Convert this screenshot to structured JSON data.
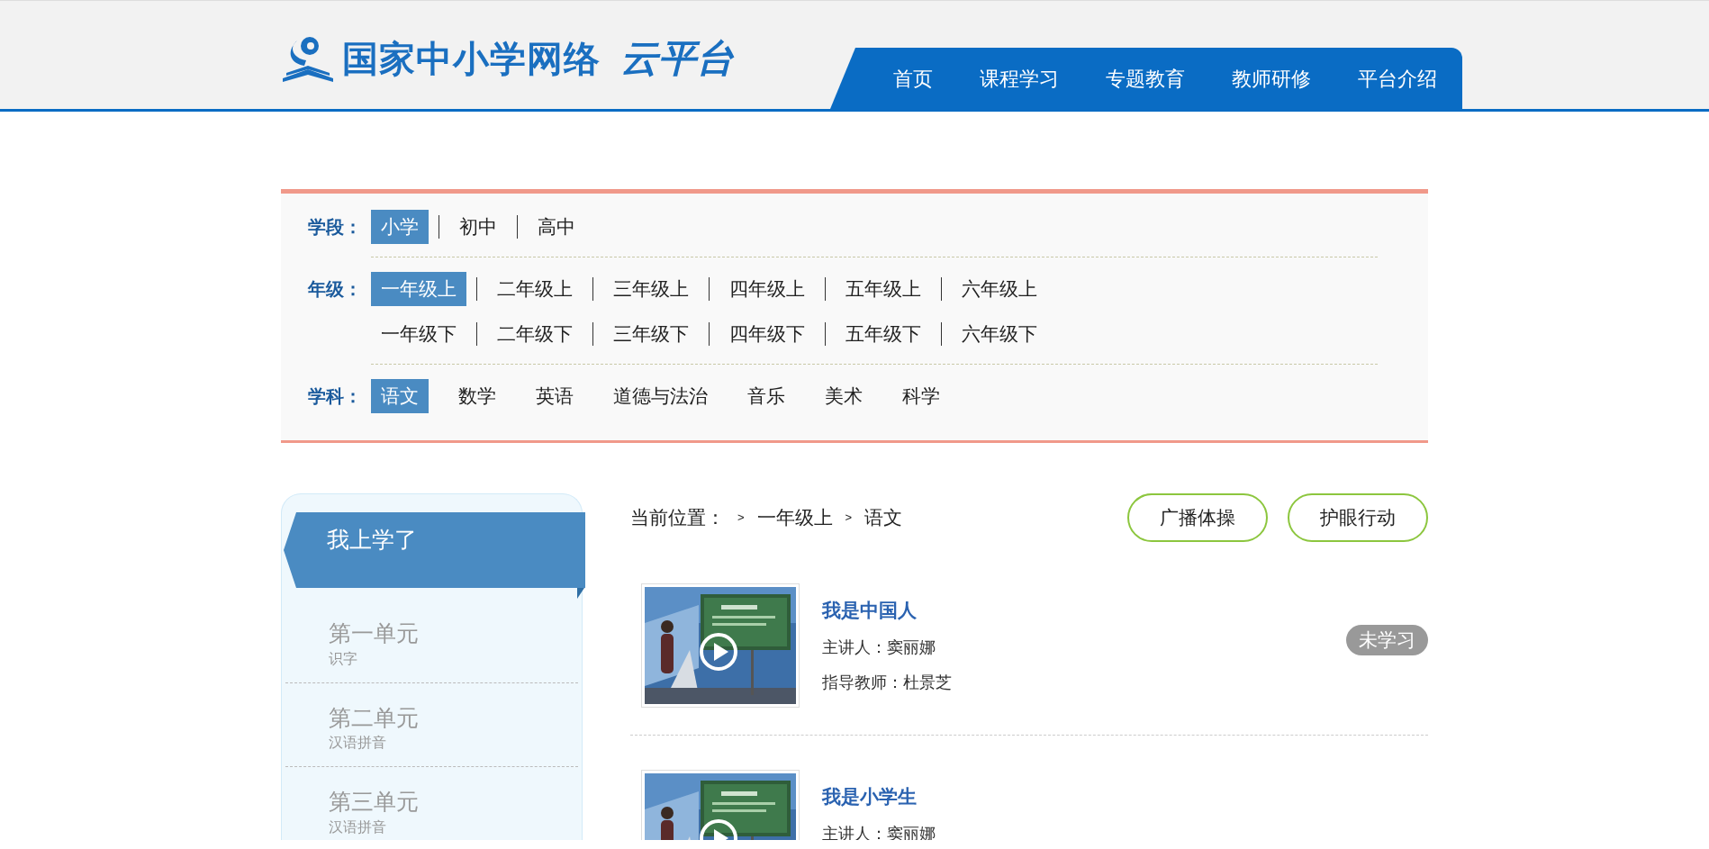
{
  "header": {
    "logo_text": "国家中小学网络",
    "logo_brand": "云平台",
    "nav": [
      {
        "label": "首页"
      },
      {
        "label": "课程学习"
      },
      {
        "label": "专题教育"
      },
      {
        "label": "教师研修"
      },
      {
        "label": "平台介绍"
      }
    ]
  },
  "filters": [
    {
      "label": "学段：",
      "dividers": true,
      "rows": [
        [
          {
            "label": "小学",
            "selected": true
          },
          {
            "label": "初中",
            "selected": false
          },
          {
            "label": "高中",
            "selected": false
          }
        ]
      ]
    },
    {
      "label": "年级：",
      "dividers": true,
      "rows": [
        [
          {
            "label": "一年级上",
            "selected": true
          },
          {
            "label": "二年级上",
            "selected": false
          },
          {
            "label": "三年级上",
            "selected": false
          },
          {
            "label": "四年级上",
            "selected": false
          },
          {
            "label": "五年级上",
            "selected": false
          },
          {
            "label": "六年级上",
            "selected": false
          }
        ],
        [
          {
            "label": "一年级下",
            "selected": false
          },
          {
            "label": "二年级下",
            "selected": false
          },
          {
            "label": "三年级下",
            "selected": false
          },
          {
            "label": "四年级下",
            "selected": false
          },
          {
            "label": "五年级下",
            "selected": false
          },
          {
            "label": "六年级下",
            "selected": false
          }
        ]
      ]
    },
    {
      "label": "学科：",
      "dividers": false,
      "rows": [
        [
          {
            "label": "语文",
            "selected": true
          },
          {
            "label": "数学",
            "selected": false
          },
          {
            "label": "英语",
            "selected": false
          },
          {
            "label": "道德与法治",
            "selected": false
          },
          {
            "label": "音乐",
            "selected": false
          },
          {
            "label": "美术",
            "selected": false
          },
          {
            "label": "科学",
            "selected": false
          }
        ]
      ]
    }
  ],
  "sidebar": {
    "title": "我上学了",
    "units": [
      {
        "title": "第一单元",
        "subtitle": "识字"
      },
      {
        "title": "第二单元",
        "subtitle": "汉语拼音"
      },
      {
        "title": "第三单元",
        "subtitle": "汉语拼音"
      }
    ]
  },
  "breadcrumb": {
    "label": "当前位置：",
    "separator": ">",
    "items": [
      "一年级上",
      "语文"
    ]
  },
  "action_buttons": [
    "广播体操",
    "护眼行动"
  ],
  "lessons": [
    {
      "title": "我是中国人",
      "lecturer": "主讲人：窦丽娜",
      "advisor": "指导教师：杜景芝",
      "status": "未学习"
    },
    {
      "title": "我是小学生",
      "lecturer": "主讲人：窦丽娜"
    }
  ]
}
